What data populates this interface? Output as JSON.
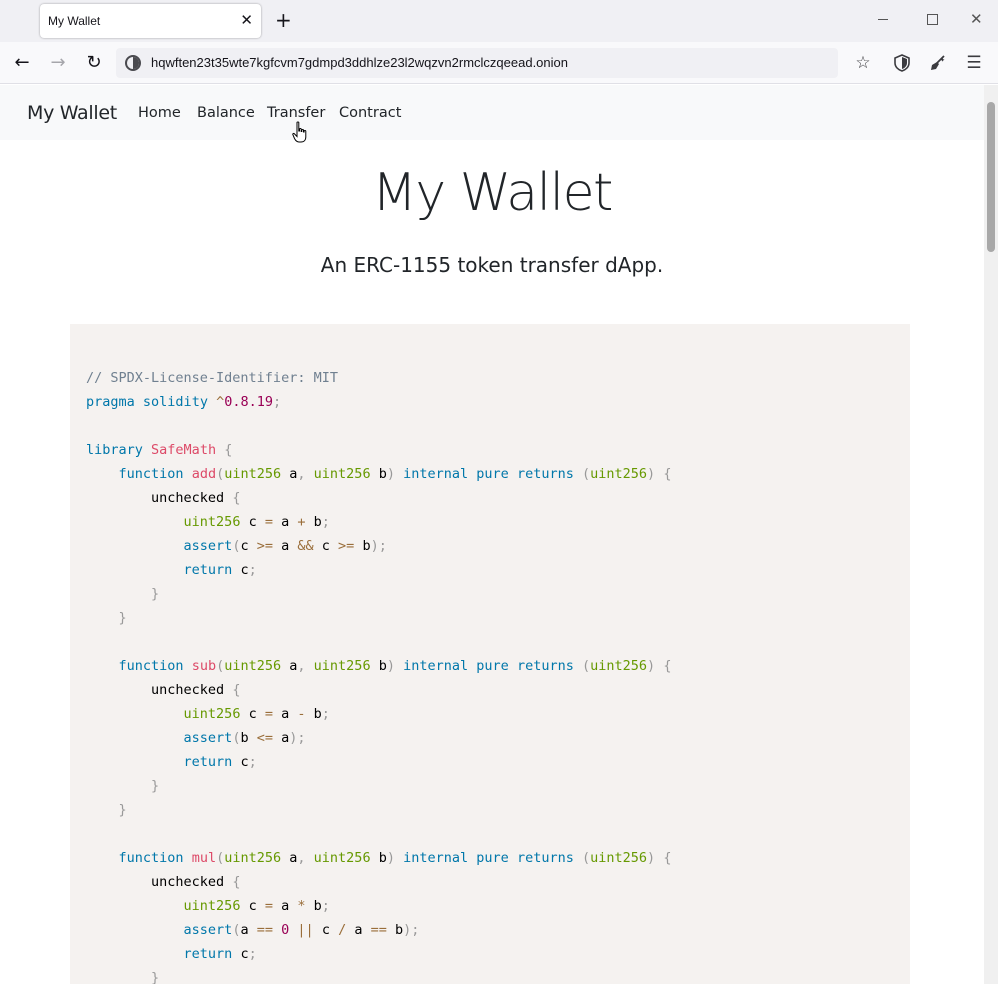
{
  "browser": {
    "tab_title": "My Wallet",
    "tab_close": "✕",
    "new_tab": "+",
    "url": "hqwften23t35wte7kgfcvm7gdmpd3ddhlze23l2wqzvn2rmclczqeead.onion",
    "icons": {
      "back": "back-arrow-icon",
      "forward": "forward-arrow-icon",
      "reload": "reload-icon",
      "bookmark": "star-icon",
      "shield": "shield-icon",
      "new_identity": "broom-icon",
      "menu": "hamburger-menu-icon"
    }
  },
  "navbar": {
    "brand": "My Wallet",
    "links": [
      {
        "label": "Home"
      },
      {
        "label": "Balance"
      },
      {
        "label": "Transfer"
      },
      {
        "label": "Contract"
      }
    ]
  },
  "hero": {
    "title": "My Wallet",
    "subtitle": "An ERC-1155 token transfer dApp."
  },
  "colors": {
    "code_background": "#f5f2f0",
    "comment": "#708090",
    "keyword": "#0077aa",
    "type": "#669900",
    "function": "#dd4a68",
    "punctuation": "#999999",
    "operator": "#9a6e3a",
    "number": "#990055"
  },
  "code": {
    "lines": [
      [
        [
          "comment",
          "// SPDX-License-Identifier: MIT"
        ]
      ],
      [
        [
          "keyword",
          "pragma"
        ],
        [
          "plain",
          " "
        ],
        [
          "keyword",
          "solidity"
        ],
        [
          "plain",
          " "
        ],
        [
          "op",
          "^"
        ],
        [
          "number",
          "0.8.19"
        ],
        [
          "punct",
          ";"
        ]
      ],
      [],
      [
        [
          "keyword",
          "library"
        ],
        [
          "plain",
          " "
        ],
        [
          "func",
          "SafeMath"
        ],
        [
          "plain",
          " "
        ],
        [
          "punct",
          "{"
        ]
      ],
      [
        [
          "plain",
          "    "
        ],
        [
          "keyword",
          "function"
        ],
        [
          "plain",
          " "
        ],
        [
          "func",
          "add"
        ],
        [
          "punct",
          "("
        ],
        [
          "type",
          "uint256"
        ],
        [
          "plain",
          " a"
        ],
        [
          "punct",
          ","
        ],
        [
          "plain",
          " "
        ],
        [
          "type",
          "uint256"
        ],
        [
          "plain",
          " b"
        ],
        [
          "punct",
          ")"
        ],
        [
          "plain",
          " "
        ],
        [
          "keyword",
          "internal"
        ],
        [
          "plain",
          " "
        ],
        [
          "keyword",
          "pure"
        ],
        [
          "plain",
          " "
        ],
        [
          "keyword",
          "returns"
        ],
        [
          "plain",
          " "
        ],
        [
          "punct",
          "("
        ],
        [
          "type",
          "uint256"
        ],
        [
          "punct",
          ")"
        ],
        [
          "plain",
          " "
        ],
        [
          "punct",
          "{"
        ]
      ],
      [
        [
          "plain",
          "        unchecked "
        ],
        [
          "punct",
          "{"
        ]
      ],
      [
        [
          "plain",
          "            "
        ],
        [
          "type",
          "uint256"
        ],
        [
          "plain",
          " c "
        ],
        [
          "op",
          "="
        ],
        [
          "plain",
          " a "
        ],
        [
          "op",
          "+"
        ],
        [
          "plain",
          " b"
        ],
        [
          "punct",
          ";"
        ]
      ],
      [
        [
          "plain",
          "            "
        ],
        [
          "keyword",
          "assert"
        ],
        [
          "punct",
          "("
        ],
        [
          "plain",
          "c "
        ],
        [
          "op",
          ">="
        ],
        [
          "plain",
          " a "
        ],
        [
          "op",
          "&&"
        ],
        [
          "plain",
          " c "
        ],
        [
          "op",
          ">="
        ],
        [
          "plain",
          " b"
        ],
        [
          "punct",
          ")"
        ],
        [
          "punct",
          ";"
        ]
      ],
      [
        [
          "plain",
          "            "
        ],
        [
          "keyword",
          "return"
        ],
        [
          "plain",
          " c"
        ],
        [
          "punct",
          ";"
        ]
      ],
      [
        [
          "plain",
          "        "
        ],
        [
          "punct",
          "}"
        ]
      ],
      [
        [
          "plain",
          "    "
        ],
        [
          "punct",
          "}"
        ]
      ],
      [],
      [
        [
          "plain",
          "    "
        ],
        [
          "keyword",
          "function"
        ],
        [
          "plain",
          " "
        ],
        [
          "func",
          "sub"
        ],
        [
          "punct",
          "("
        ],
        [
          "type",
          "uint256"
        ],
        [
          "plain",
          " a"
        ],
        [
          "punct",
          ","
        ],
        [
          "plain",
          " "
        ],
        [
          "type",
          "uint256"
        ],
        [
          "plain",
          " b"
        ],
        [
          "punct",
          ")"
        ],
        [
          "plain",
          " "
        ],
        [
          "keyword",
          "internal"
        ],
        [
          "plain",
          " "
        ],
        [
          "keyword",
          "pure"
        ],
        [
          "plain",
          " "
        ],
        [
          "keyword",
          "returns"
        ],
        [
          "plain",
          " "
        ],
        [
          "punct",
          "("
        ],
        [
          "type",
          "uint256"
        ],
        [
          "punct",
          ")"
        ],
        [
          "plain",
          " "
        ],
        [
          "punct",
          "{"
        ]
      ],
      [
        [
          "plain",
          "        unchecked "
        ],
        [
          "punct",
          "{"
        ]
      ],
      [
        [
          "plain",
          "            "
        ],
        [
          "type",
          "uint256"
        ],
        [
          "plain",
          " c "
        ],
        [
          "op",
          "="
        ],
        [
          "plain",
          " a "
        ],
        [
          "op",
          "-"
        ],
        [
          "plain",
          " b"
        ],
        [
          "punct",
          ";"
        ]
      ],
      [
        [
          "plain",
          "            "
        ],
        [
          "keyword",
          "assert"
        ],
        [
          "punct",
          "("
        ],
        [
          "plain",
          "b "
        ],
        [
          "op",
          "<="
        ],
        [
          "plain",
          " a"
        ],
        [
          "punct",
          ")"
        ],
        [
          "punct",
          ";"
        ]
      ],
      [
        [
          "plain",
          "            "
        ],
        [
          "keyword",
          "return"
        ],
        [
          "plain",
          " c"
        ],
        [
          "punct",
          ";"
        ]
      ],
      [
        [
          "plain",
          "        "
        ],
        [
          "punct",
          "}"
        ]
      ],
      [
        [
          "plain",
          "    "
        ],
        [
          "punct",
          "}"
        ]
      ],
      [],
      [
        [
          "plain",
          "    "
        ],
        [
          "keyword",
          "function"
        ],
        [
          "plain",
          " "
        ],
        [
          "func",
          "mul"
        ],
        [
          "punct",
          "("
        ],
        [
          "type",
          "uint256"
        ],
        [
          "plain",
          " a"
        ],
        [
          "punct",
          ","
        ],
        [
          "plain",
          " "
        ],
        [
          "type",
          "uint256"
        ],
        [
          "plain",
          " b"
        ],
        [
          "punct",
          ")"
        ],
        [
          "plain",
          " "
        ],
        [
          "keyword",
          "internal"
        ],
        [
          "plain",
          " "
        ],
        [
          "keyword",
          "pure"
        ],
        [
          "plain",
          " "
        ],
        [
          "keyword",
          "returns"
        ],
        [
          "plain",
          " "
        ],
        [
          "punct",
          "("
        ],
        [
          "type",
          "uint256"
        ],
        [
          "punct",
          ")"
        ],
        [
          "plain",
          " "
        ],
        [
          "punct",
          "{"
        ]
      ],
      [
        [
          "plain",
          "        unchecked "
        ],
        [
          "punct",
          "{"
        ]
      ],
      [
        [
          "plain",
          "            "
        ],
        [
          "type",
          "uint256"
        ],
        [
          "plain",
          " c "
        ],
        [
          "op",
          "="
        ],
        [
          "plain",
          " a "
        ],
        [
          "op",
          "*"
        ],
        [
          "plain",
          " b"
        ],
        [
          "punct",
          ";"
        ]
      ],
      [
        [
          "plain",
          "            "
        ],
        [
          "keyword",
          "assert"
        ],
        [
          "punct",
          "("
        ],
        [
          "plain",
          "a "
        ],
        [
          "op",
          "=="
        ],
        [
          "plain",
          " "
        ],
        [
          "number",
          "0"
        ],
        [
          "plain",
          " "
        ],
        [
          "op",
          "||"
        ],
        [
          "plain",
          " c "
        ],
        [
          "op",
          "/"
        ],
        [
          "plain",
          " a "
        ],
        [
          "op",
          "=="
        ],
        [
          "plain",
          " b"
        ],
        [
          "punct",
          ")"
        ],
        [
          "punct",
          ";"
        ]
      ],
      [
        [
          "plain",
          "            "
        ],
        [
          "keyword",
          "return"
        ],
        [
          "plain",
          " c"
        ],
        [
          "punct",
          ";"
        ]
      ],
      [
        [
          "plain",
          "        "
        ],
        [
          "punct",
          "}"
        ]
      ]
    ]
  }
}
